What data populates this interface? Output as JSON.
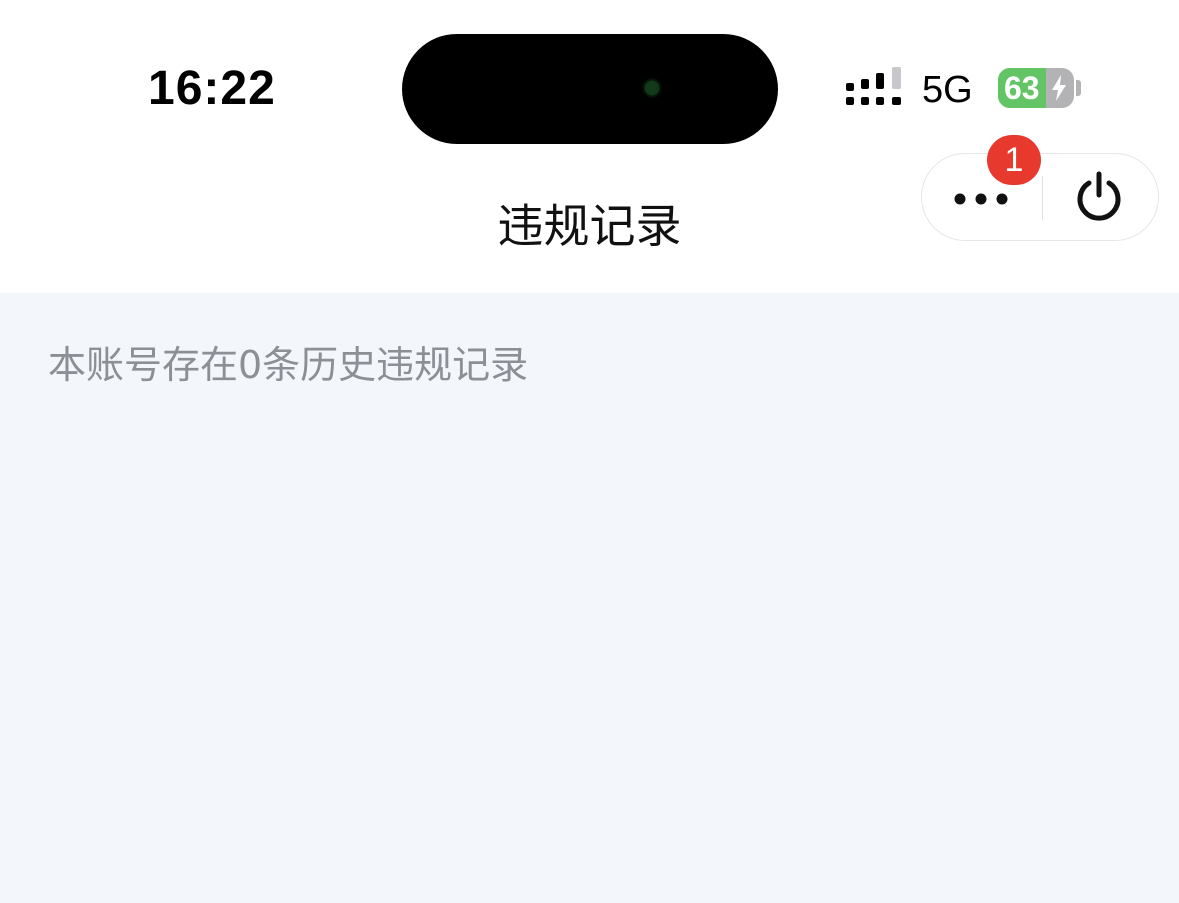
{
  "status_bar": {
    "time": "16:22",
    "network": "5G",
    "battery_percent": "63",
    "battery_level": 0.63,
    "charging": true,
    "battery_color": "#63c466",
    "icons": [
      "signal-bars-icon",
      "battery-charging-icon"
    ]
  },
  "nav": {
    "title": "违规记录",
    "more_badge": "1",
    "icons": [
      "more-dots-icon",
      "power-icon"
    ],
    "badge_color": "#e8392e"
  },
  "content": {
    "notice": "本账号存在0条历史违规记录",
    "background_color": "#f3f6fa"
  }
}
